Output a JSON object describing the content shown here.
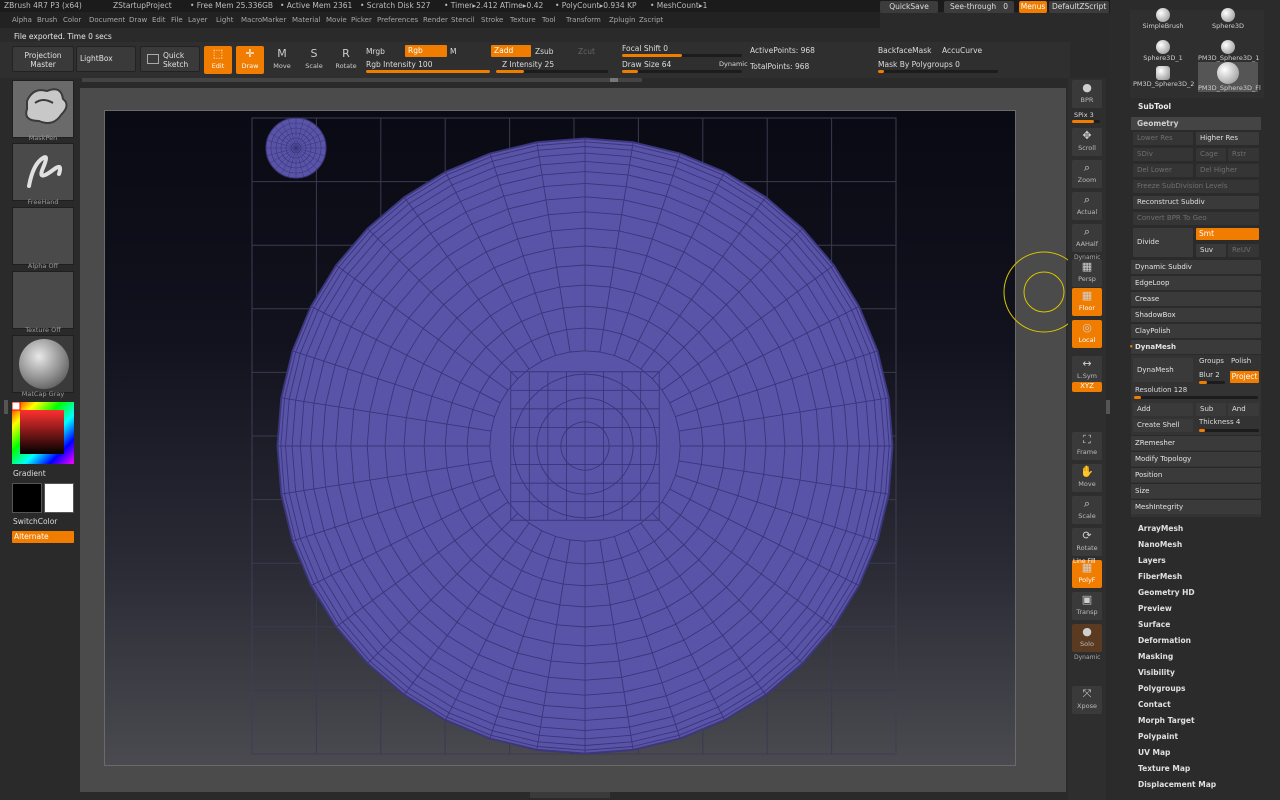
{
  "titlebar": {
    "app": "ZBrush 4R7 P3 (x64)",
    "project": "ZStartupProject",
    "free_mem": "• Free Mem 25.336GB",
    "active_mem": "• Active Mem 2361",
    "scratch": "• Scratch Disk 527",
    "timer": "• Timer▸2.412 ATime▸0.42",
    "polycount": "• PolyCount▸0.934 KP",
    "meshcount": "• MeshCount▸1"
  },
  "top_right": {
    "quicksave": "QuickSave",
    "seethrough": "See-through",
    "seethrough_val": "0",
    "menus": "Menus",
    "script": "DefaultZScript"
  },
  "menus": [
    "Alpha",
    "Brush",
    "Color",
    "Document",
    "Draw",
    "Edit",
    "File",
    "Layer",
    "Light",
    "Macro",
    "Marker",
    "Material",
    "Movie",
    "Picker",
    "Preferences",
    "Render",
    "Stencil",
    "Stroke",
    "Texture",
    "Tool",
    "Transform",
    "Zplugin",
    "Zscript"
  ],
  "status": "File exported. Time 0 secs",
  "shelf": {
    "projection_master": "Projection Master",
    "lightbox": "LightBox",
    "quick_sketch": "Quick Sketch",
    "edit": "Edit",
    "draw": "Draw",
    "move": "Move",
    "scale": "Scale",
    "rotate": "Rotate",
    "mrgb": "Mrgb",
    "rgb": "Rgb",
    "m": "M",
    "rgb_intensity": "Rgb Intensity 100",
    "zadd": "Zadd",
    "zsub": "Zsub",
    "zcut": "Zcut",
    "z_intensity": "Z Intensity 25",
    "focal_shift": "Focal Shift 0",
    "draw_size": "Draw Size 64",
    "dynamic": "Dynamic",
    "active_points": "ActivePoints: 968",
    "total_points": "TotalPoints: 968",
    "backface_mask": "BackfaceMask",
    "accucurve": "AccuCurve",
    "mask_by_polygroups": "Mask By Polygroups 0",
    "rgb_intensity_level": 1.0,
    "z_intensity_level": 0.25,
    "focal_shift_level": 0.5,
    "draw_size_level": 0.13
  },
  "left_tray": {
    "brush": "MaskPen",
    "stroke": "FreeHand",
    "alpha": "Alpha Off",
    "texture": "Texture Off",
    "material": "MatCap Gray",
    "gradient": "Gradient",
    "switch_color": "SwitchColor",
    "alternate": "Alternate"
  },
  "right_strip": [
    {
      "name": "bpr-icon",
      "label": "BPR",
      "glyph": "●"
    },
    {
      "name": "scroll-icon",
      "label": "Scroll",
      "glyph": "✥"
    },
    {
      "name": "zoom-icon",
      "label": "Zoom",
      "glyph": "⌕"
    },
    {
      "name": "actual-icon",
      "label": "Actual",
      "glyph": "⌕"
    },
    {
      "name": "aahalf-icon",
      "label": "AAHalf",
      "glyph": "⌕"
    },
    {
      "name": "persp-icon",
      "label": "Persp",
      "glyph": "▦"
    },
    {
      "name": "floor-icon",
      "label": "Floor",
      "glyph": "▦"
    },
    {
      "name": "local-icon",
      "label": "Local",
      "glyph": "◎"
    },
    {
      "name": "lsym-icon",
      "label": "L.Sym",
      "glyph": "↔"
    },
    {
      "name": "xyz-icon",
      "label": "XYZ",
      "glyph": "⟲"
    },
    {
      "name": "frame-icon",
      "label": "Frame",
      "glyph": "⛶"
    },
    {
      "name": "move-icon",
      "label": "Move",
      "glyph": "✋"
    },
    {
      "name": "scale-icon",
      "label": "Scale",
      "glyph": "⌕"
    },
    {
      "name": "rotate-icon",
      "label": "Rotate",
      "glyph": "⟳"
    },
    {
      "name": "polyf-icon",
      "label": "PolyF",
      "glyph": "▦"
    },
    {
      "name": "transp-icon",
      "label": "Transp",
      "glyph": "▣"
    },
    {
      "name": "solo-icon",
      "label": "Solo",
      "glyph": "●"
    },
    {
      "name": "xpose-icon",
      "label": "Xpose",
      "glyph": "⤧"
    }
  ],
  "right_strip_extra": {
    "spix": "SPix 3",
    "dynamic": "Dynamic",
    "line_fill": "Line Fill",
    "dynamic2": "Dynamic"
  },
  "subtools": [
    {
      "label": "SimpleBrush"
    },
    {
      "label": "Sphere3D"
    },
    {
      "label": "Sphere3D_1"
    },
    {
      "label": "PM3D_Sphere3D_1"
    },
    {
      "label": "PM3D_Sphere3D_2"
    },
    {
      "label": "PM3D_Sphere3D_Fl"
    }
  ],
  "rpanel": {
    "subtool": "SubTool",
    "geometry": "Geometry",
    "lower_res": "Lower Res",
    "higher_res": "Higher Res",
    "sdiv": "SDiv",
    "cage": "Cage",
    "rstr": "Rstr",
    "del_lower": "Del Lower",
    "del_higher": "Del Higher",
    "freeze": "Freeze SubDivision Levels",
    "reconstruct": "Reconstruct Subdiv",
    "convert_bpr": "Convert BPR To Geo",
    "divide": "Divide",
    "smt": "Smt",
    "suv": "Suv",
    "reluv": "ReUV",
    "dynamic_subdiv": "Dynamic Subdiv",
    "edgeloop": "EdgeLoop",
    "crease": "Crease",
    "shadowbox": "ShadowBox",
    "claypolish": "ClayPolish",
    "dynamesh_title": "DynaMesh",
    "dynamesh": "DynaMesh",
    "groups": "Groups",
    "polish": "Polish",
    "blur": "Blur 2",
    "project": "Project",
    "resolution": "Resolution 128",
    "add": "Add",
    "sub": "Sub",
    "and": "And",
    "create_shell": "Create Shell",
    "thickness": "Thickness 4",
    "zremesher": "ZRemesher",
    "modify_topology": "Modify Topology",
    "position": "Position",
    "size": "Size",
    "meshintegrity": "MeshIntegrity",
    "resolution_level": 0.06,
    "thickness_level": 0.1
  },
  "tool_menu": [
    "ArrayMesh",
    "NanoMesh",
    "Layers",
    "FiberMesh",
    "Geometry HD",
    "Preview",
    "Surface",
    "Deformation",
    "Masking",
    "Visibility",
    "Polygroups",
    "Contact",
    "Morph Target",
    "Polypaint",
    "UV Map",
    "Texture Map",
    "Displacement Map"
  ],
  "colors": {
    "accent": "#f07c00",
    "mesh_fill": "#5a54a8",
    "mesh_wire": "#3a357a",
    "cursor": "#d8c400"
  }
}
